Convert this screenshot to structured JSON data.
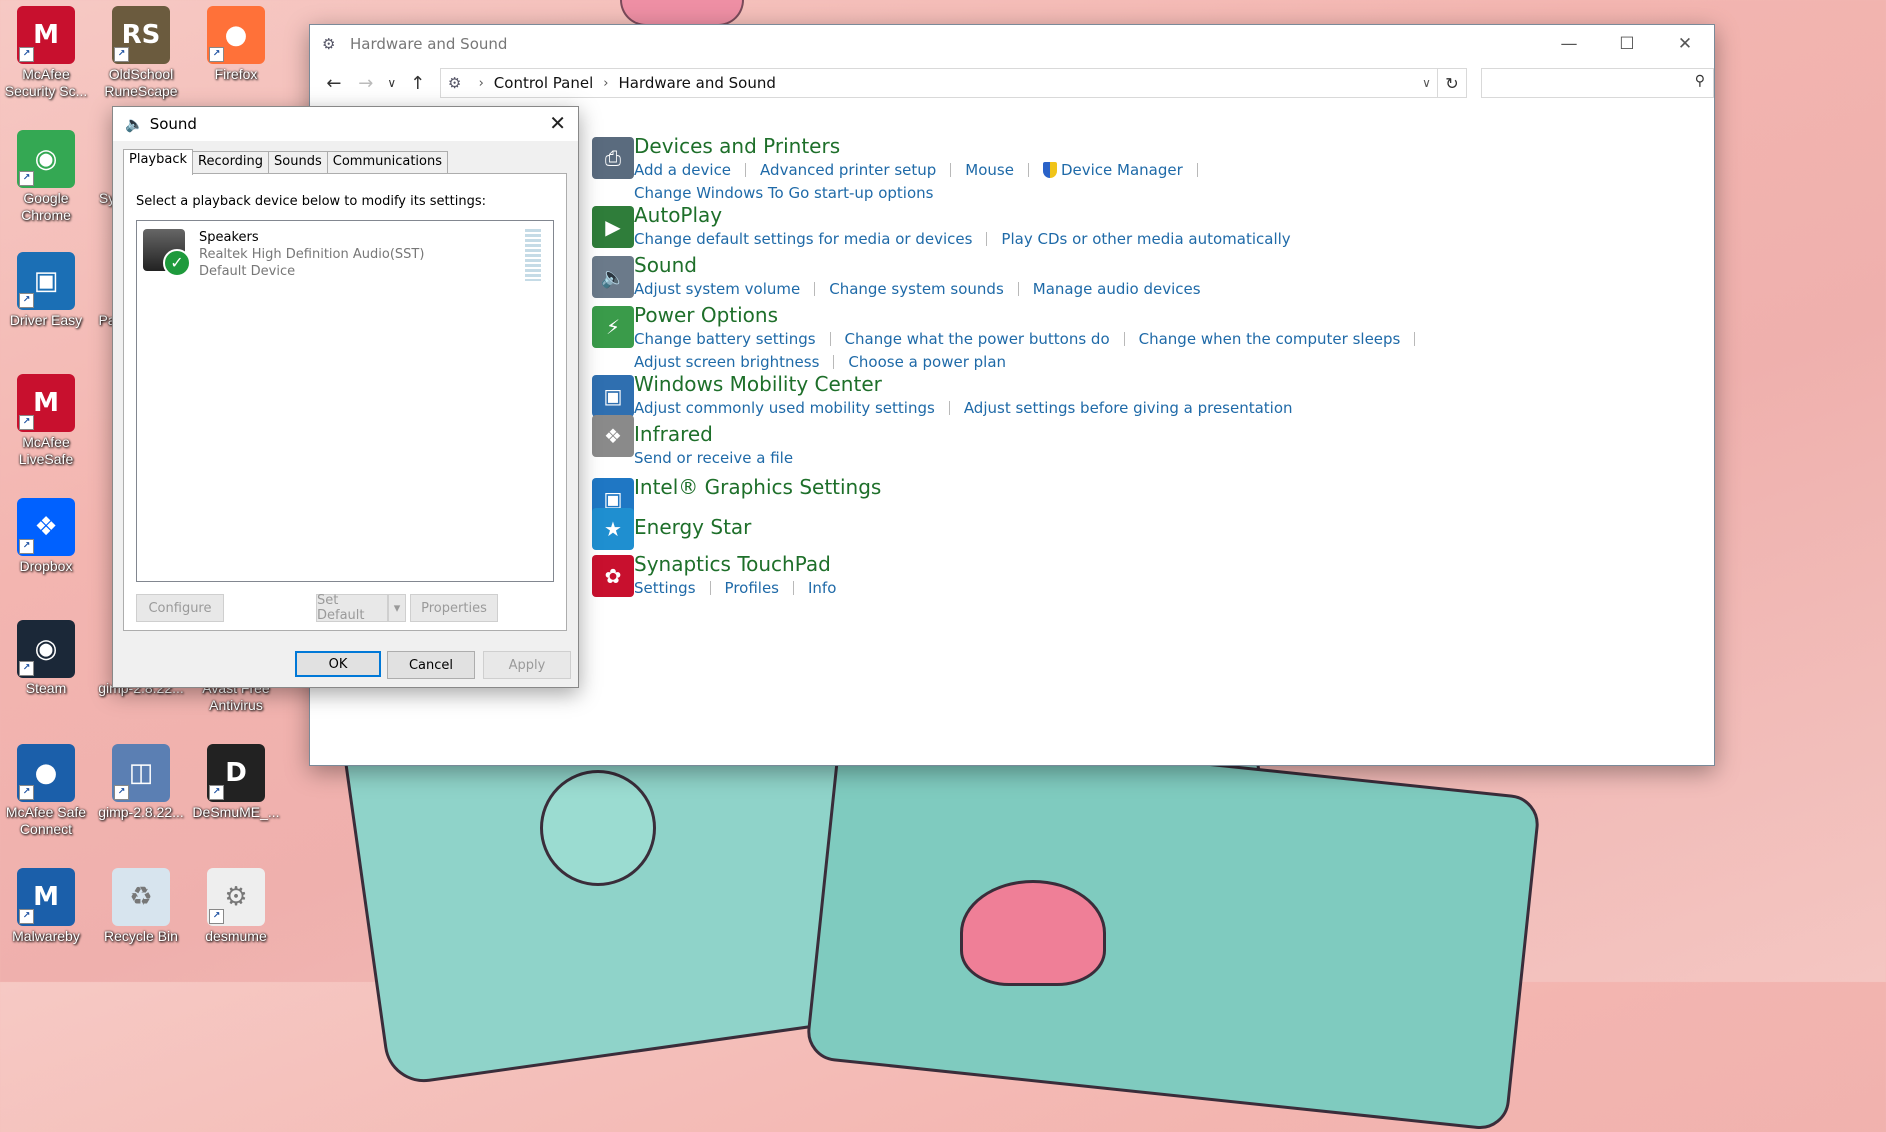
{
  "desktop": {
    "icons": [
      {
        "label": "McAfee Security Sc...",
        "icon": "mcafee-icon",
        "color": "#c8102e"
      },
      {
        "label": "OldSchool RuneScape",
        "icon": "runescape-icon",
        "color": "#6b5b3e"
      },
      {
        "label": "Firefox",
        "icon": "firefox-icon",
        "color": "#ff7139"
      },
      {
        "label": "Google Chrome",
        "icon": "chrome-icon",
        "color": "#34a853"
      },
      {
        "label": "Driver Easy",
        "icon": "drivereasy-icon",
        "color": "#1b6fb5"
      },
      {
        "label": "McAfee LiveSafe",
        "icon": "mcafee-icon",
        "color": "#c8102e"
      },
      {
        "label": "Dropbox",
        "icon": "dropbox-icon",
        "color": "#0061ff"
      },
      {
        "label": "Steam",
        "icon": "steam-icon",
        "color": "#1b2838"
      },
      {
        "label": "gimp-2.8.22...",
        "icon": "gimp-icon",
        "color": "#7a6a4a"
      },
      {
        "label": "Avast Free Antivirus",
        "icon": "avast-icon",
        "color": "#ff7800"
      },
      {
        "label": "McAfee Safe Connect",
        "icon": "mcafee-safeconnect-icon",
        "color": "#1b5faa"
      },
      {
        "label": "gimp-2.8.22...",
        "icon": "installer-icon",
        "color": "#5b7fb3"
      },
      {
        "label": "DeSmuME_...",
        "icon": "desmume-icon",
        "color": "#222222"
      },
      {
        "label": "Malwareby",
        "icon": "malwarebytes-icon",
        "color": "#1b5faa"
      },
      {
        "label": "Recycle Bin",
        "icon": "recycle-bin-icon",
        "color": "#d7e4ee"
      },
      {
        "label": "desmume",
        "icon": "file-icon",
        "color": "#eeeeee"
      },
      {
        "label": "Sy",
        "icon": "partial-icon",
        "color": "#888888"
      },
      {
        "label": "Pa",
        "icon": "partial-icon",
        "color": "#888888"
      }
    ]
  },
  "control_panel": {
    "title": "Hardware and Sound",
    "breadcrumb": [
      "Control Panel",
      "Hardware and Sound"
    ],
    "search_placeholder": "",
    "categories": [
      {
        "name": "Devices and Printers",
        "icon": "printer-icon",
        "lines": [
          [
            "Add a device",
            "Advanced printer setup",
            "Mouse",
            "Device Manager"
          ],
          [
            "Change Windows To Go start-up options"
          ]
        ]
      },
      {
        "name": "AutoPlay",
        "icon": "autoplay-icon",
        "lines": [
          [
            "Change default settings for media or devices",
            "Play CDs or other media automatically"
          ]
        ]
      },
      {
        "name": "Sound",
        "icon": "speaker-icon",
        "lines": [
          [
            "Adjust system volume",
            "Change system sounds",
            "Manage audio devices"
          ]
        ]
      },
      {
        "name": "Power Options",
        "icon": "power-icon",
        "lines": [
          [
            "Change battery settings",
            "Change what the power buttons do",
            "Change when the computer sleeps"
          ],
          [
            "Adjust screen brightness",
            "Choose a power plan"
          ]
        ]
      },
      {
        "name": "Windows Mobility Center",
        "icon": "mobility-icon",
        "lines": [
          [
            "Adjust commonly used mobility settings",
            "Adjust settings before giving a presentation"
          ]
        ]
      },
      {
        "name": "Infrared",
        "icon": "infrared-icon",
        "lines": [
          [
            "Send or receive a file"
          ]
        ]
      },
      {
        "name": "Intel® Graphics Settings",
        "icon": "intel-graphics-icon",
        "lines": []
      },
      {
        "name": "Energy Star",
        "icon": "energy-star-icon",
        "lines": []
      },
      {
        "name": "Synaptics TouchPad",
        "icon": "synaptics-icon",
        "lines": [
          [
            "Settings",
            "Profiles",
            "Info"
          ]
        ]
      }
    ]
  },
  "sound_dialog": {
    "title": "Sound",
    "tabs": [
      "Playback",
      "Recording",
      "Sounds",
      "Communications"
    ],
    "instruction": "Select a playback device below to modify its settings:",
    "device": {
      "name": "Speakers",
      "driver": "Realtek High Definition Audio(SST)",
      "status": "Default Device"
    },
    "buttons": {
      "configure": "Configure",
      "set_default": "Set Default",
      "properties": "Properties",
      "ok": "OK",
      "cancel": "Cancel",
      "apply": "Apply"
    }
  },
  "colors": {
    "link": "#1f6aa8",
    "heading": "#1e6f2a"
  }
}
